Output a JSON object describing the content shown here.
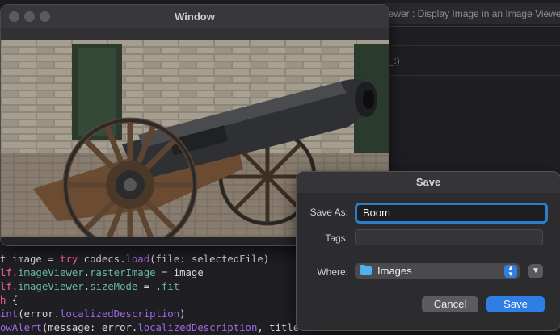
{
  "editor": {
    "title_fragment": "iewer : Display Image in an Image Viewer",
    "method_fragment": "d(_:)",
    "code_lines": [
      {
        "segments": [
          {
            "t": "t image = ",
            "c": ""
          },
          {
            "t": "try",
            "c": "kw"
          },
          {
            "t": " codecs.",
            "c": ""
          },
          {
            "t": "load",
            "c": "fn"
          },
          {
            "t": "(file: selectedFile)",
            "c": ""
          }
        ]
      },
      {
        "segments": [
          {
            "t": "lf.",
            "c": "kw"
          },
          {
            "t": "imageViewer",
            "c": "prop"
          },
          {
            "t": ".",
            "c": ""
          },
          {
            "t": "rasterImage",
            "c": "prop"
          },
          {
            "t": " = image",
            "c": ""
          }
        ]
      },
      {
        "segments": [
          {
            "t": "lf.",
            "c": "kw"
          },
          {
            "t": "imageViewer",
            "c": "prop"
          },
          {
            "t": ".",
            "c": ""
          },
          {
            "t": "sizeMode",
            "c": "prop"
          },
          {
            "t": " = .",
            "c": ""
          },
          {
            "t": "fit",
            "c": "prop"
          }
        ]
      },
      {
        "segments": [
          {
            "t": "h",
            "c": "kw"
          },
          {
            "t": " {",
            "c": ""
          }
        ]
      },
      {
        "segments": [
          {
            "t": "int",
            "c": "fn"
          },
          {
            "t": "(error.",
            "c": ""
          },
          {
            "t": "localizedDescription",
            "c": "fn"
          },
          {
            "t": ")",
            "c": ""
          }
        ]
      },
      {
        "segments": [
          {
            "t": "owAlert",
            "c": "fn"
          },
          {
            "t": "(message: error.",
            "c": ""
          },
          {
            "t": "localizedDescription",
            "c": "fn"
          },
          {
            "t": ", title",
            "c": ""
          }
        ]
      }
    ]
  },
  "image_window": {
    "title": "Window"
  },
  "save_dialog": {
    "title": "Save",
    "save_as_label": "Save As:",
    "save_as_value": "Boom",
    "tags_label": "Tags:",
    "tags_value": "",
    "where_label": "Where:",
    "where_value": "Images",
    "cancel_label": "Cancel",
    "save_label": "Save"
  },
  "icons": {
    "folder": "folder-icon",
    "stepper": "up-down-chevron-icon",
    "expand": "chevron-down-icon"
  },
  "colors": {
    "accent": "#2e7ee6",
    "focus_ring": "#2a7fc8",
    "folder": "#4fb1ee"
  }
}
